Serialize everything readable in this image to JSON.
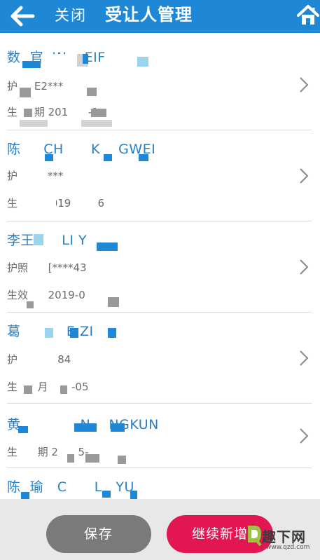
{
  "header": {
    "close_label": "关闭",
    "title": "受让人管理"
  },
  "items": [
    {
      "name": "数  官  W    EIF",
      "passport": "护     E2***",
      "birth": "生     期 201      -1"
    },
    {
      "name": "陈     CH      K    GWEI",
      "passport": "护         ***",
      "birth": "生        2019        6"
    },
    {
      "name": "李王      LI Y",
      "passport": "护照      [****43",
      "birth": "生效      2019-0"
    },
    {
      "name": "葛          E ZI",
      "passport": "护            84",
      "birth": "生      月       -05"
    },
    {
      "name": "黄             N    NGKUN",
      "passport": "",
      "birth": "生      期 2      5-"
    },
    {
      "name": "陈  瑜   C      L   YU",
      "passport": "",
      "birth": ""
    }
  ],
  "footer": {
    "save_label": "保存",
    "add_more_label": "继续新增"
  },
  "watermark": {
    "text": "趣下网",
    "url": "www.qzd.com"
  },
  "colors": {
    "header_bg": "#1e88d6",
    "name_text": "#2a7fc0",
    "save_button": "#7a7a7a",
    "add_more_button": "#e21653",
    "bottom_bar": "#e8e8e8"
  },
  "icons": {
    "back": "back-arrow-icon",
    "home": "home-icon",
    "row": "chevron-right-icon"
  }
}
